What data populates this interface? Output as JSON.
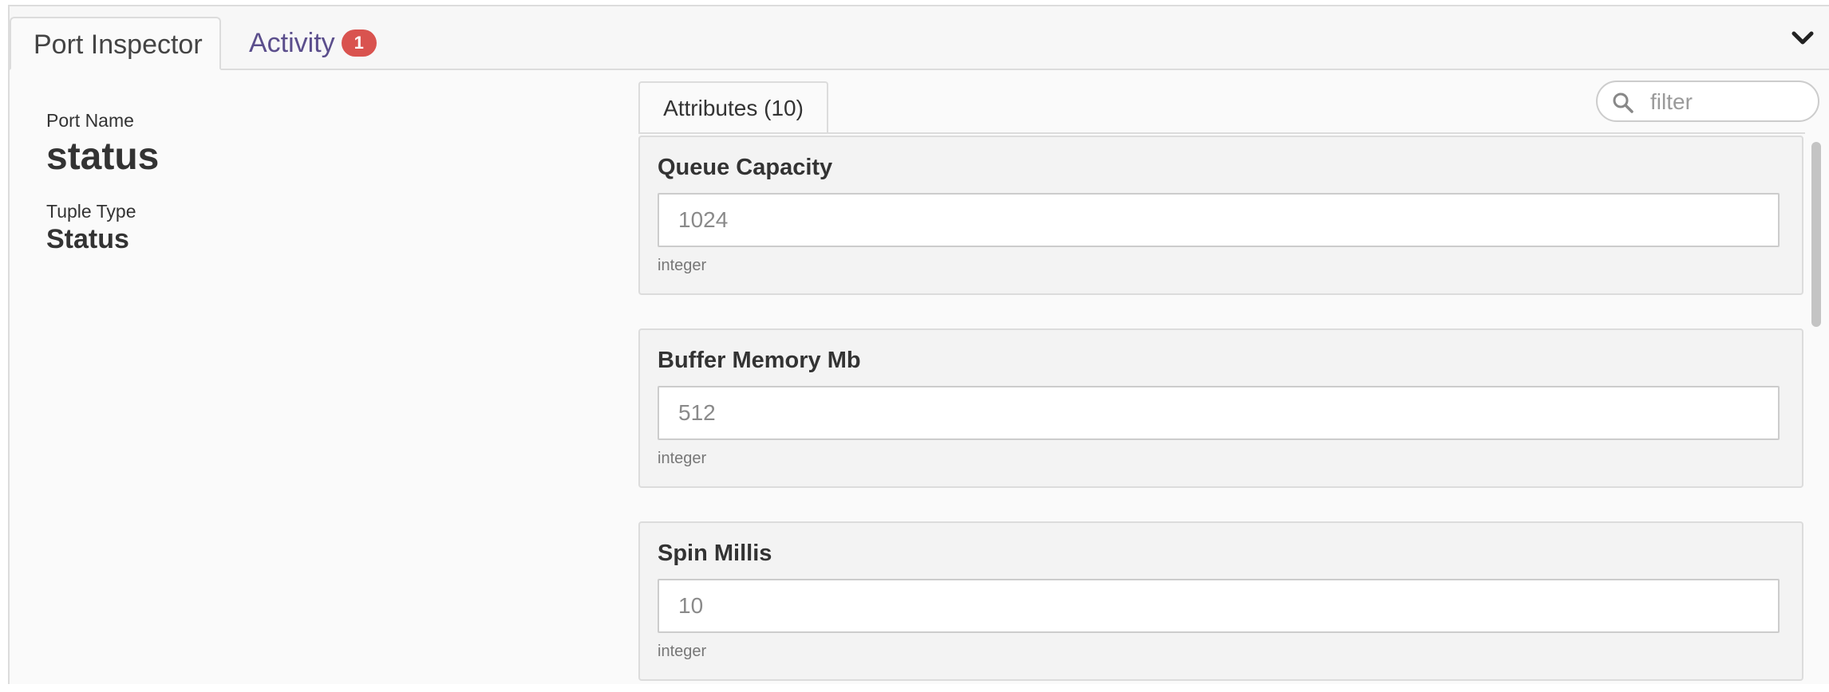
{
  "tabs": {
    "port_inspector": "Port Inspector",
    "activity": "Activity",
    "activity_badge": "1"
  },
  "port": {
    "name_label": "Port Name",
    "name_value": "status",
    "type_label": "Tuple Type",
    "type_value": "Status"
  },
  "attributes": {
    "tab_label": "Attributes (10)",
    "filter_placeholder": "filter",
    "items": [
      {
        "name": "Queue Capacity",
        "placeholder": "1024",
        "type": "integer"
      },
      {
        "name": "Buffer Memory Mb",
        "placeholder": "512",
        "type": "integer"
      },
      {
        "name": "Spin Millis",
        "placeholder": "10",
        "type": "integer"
      }
    ]
  },
  "colors": {
    "activity_text": "#5b4e8c",
    "badge_bg": "#d9534f"
  },
  "icons": {
    "collapse": "chevron-down-icon",
    "search": "search-icon"
  }
}
